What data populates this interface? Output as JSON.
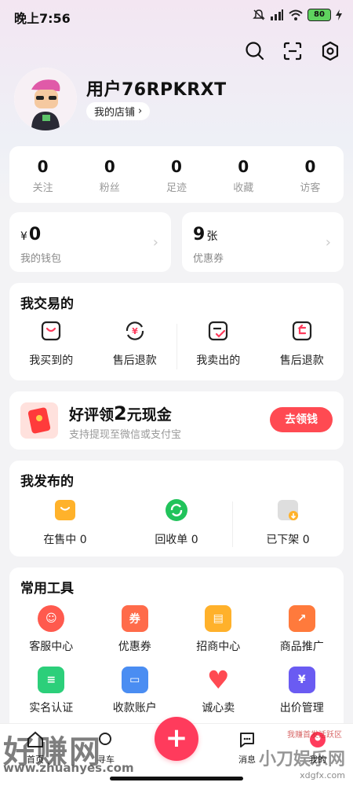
{
  "status_bar": {
    "time": "晚上7:56",
    "battery": "80"
  },
  "header": {
    "icons": [
      "search-icon",
      "scan-icon",
      "settings-icon"
    ],
    "username": "用户76RPKRXT",
    "store_label": "我的店铺",
    "store_chevron": "›"
  },
  "stats": [
    {
      "value": "0",
      "label": "关注"
    },
    {
      "value": "0",
      "label": "粉丝"
    },
    {
      "value": "0",
      "label": "足迹"
    },
    {
      "value": "0",
      "label": "收藏"
    },
    {
      "value": "0",
      "label": "访客"
    }
  ],
  "wallet": {
    "currency": "¥",
    "amount": "0",
    "label": "我的钱包",
    "chevron": "›"
  },
  "coupon": {
    "count": "9",
    "unit": "张",
    "label": "优惠券",
    "chevron": "›"
  },
  "trade": {
    "title": "我交易的",
    "items": [
      {
        "label": "我买到的",
        "icon": "bag-icon"
      },
      {
        "label": "售后退款",
        "icon": "refund-icon"
      },
      {
        "label": "我卖出的",
        "icon": "sold-icon"
      },
      {
        "label": "售后退款",
        "icon": "return-icon"
      }
    ]
  },
  "promo": {
    "title_prefix": "好评领",
    "title_amount": "2",
    "title_suffix": "元现金",
    "subtitle": "支持提现至微信或支付宝",
    "button": "去领钱"
  },
  "publish": {
    "title": "我发布的",
    "items": [
      {
        "label": "在售中 0",
        "icon": "on-sale-icon",
        "color": "#ffb22b"
      },
      {
        "label": "回收单 0",
        "icon": "recycle-icon",
        "color": "#21c35b"
      },
      {
        "label": "已下架 0",
        "icon": "off-shelf-icon",
        "color": "#d9d9d9"
      }
    ]
  },
  "tools": {
    "title": "常用工具",
    "items": [
      {
        "label": "客服中心",
        "icon": "customer-service-icon",
        "color": "#ff5a4e",
        "glyph": "☺"
      },
      {
        "label": "优惠券",
        "icon": "coupon-icon",
        "color": "#ff6b4a",
        "glyph": "券"
      },
      {
        "label": "招商中心",
        "icon": "store-icon",
        "color": "#ffb12b",
        "glyph": "▤"
      },
      {
        "label": "商品推广",
        "icon": "promotion-icon",
        "color": "#ff7a3c",
        "glyph": "↗"
      },
      {
        "label": "实名认证",
        "icon": "id-verify-icon",
        "color": "#2ccf7a",
        "glyph": "≡"
      },
      {
        "label": "收款账户",
        "icon": "card-icon",
        "color": "#4a8df2",
        "glyph": "▭"
      },
      {
        "label": "诚心卖",
        "icon": "heart-icon",
        "color": "#ff4a52",
        "glyph": "♥"
      },
      {
        "label": "出价管理",
        "icon": "bid-icon",
        "color": "#6a5bf2",
        "glyph": "¥"
      }
    ]
  },
  "bottom_nav": [
    {
      "label": "首页",
      "icon": "home-icon"
    },
    {
      "label": "寻车",
      "icon": "find-icon"
    },
    {
      "label": "",
      "icon": "plus-icon"
    },
    {
      "label": "消息",
      "icon": "message-icon"
    },
    {
      "label": "我的",
      "icon": "profile-icon"
    }
  ],
  "fab": "+",
  "watermark": {
    "left_text": "好赚网",
    "left_url": "www.zhuanyes.com",
    "right_text": "小刀娱乐网",
    "right_url": "xdgfx.com",
    "small": "我赚首发活跃区"
  }
}
